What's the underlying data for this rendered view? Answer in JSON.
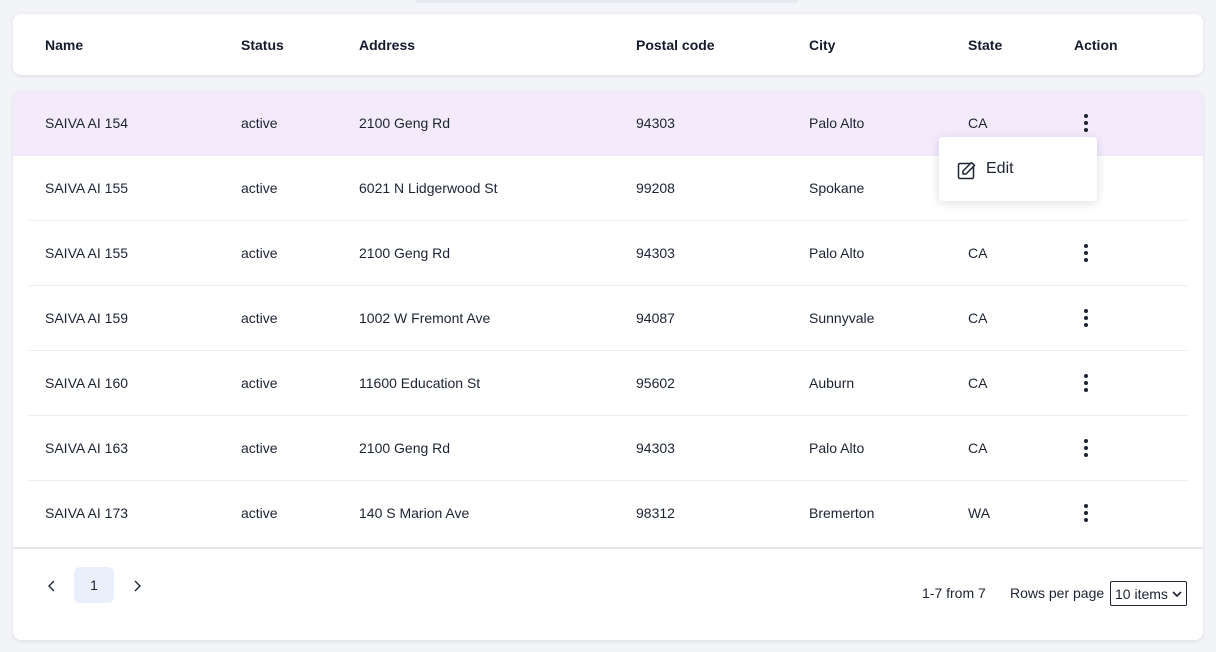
{
  "headers": {
    "name": "Name",
    "status": "Status",
    "address": "Address",
    "postal": "Postal code",
    "city": "City",
    "state": "State",
    "action": "Action"
  },
  "rows": [
    {
      "name": "SAIVA AI 154",
      "status": "active",
      "address": "2100 Geng Rd",
      "postal": "94303",
      "city": "Palo Alto",
      "state": "CA"
    },
    {
      "name": "SAIVA AI 155",
      "status": "active",
      "address": "6021 N Lidgerwood St",
      "postal": "99208",
      "city": "Spokane",
      "state": ""
    },
    {
      "name": "SAIVA AI 155",
      "status": "active",
      "address": "2100 Geng Rd",
      "postal": "94303",
      "city": "Palo Alto",
      "state": "CA"
    },
    {
      "name": "SAIVA AI 159",
      "status": "active",
      "address": "1002 W Fremont Ave",
      "postal": "94087",
      "city": "Sunnyvale",
      "state": "CA"
    },
    {
      "name": "SAIVA AI 160",
      "status": "active",
      "address": "11600 Education St",
      "postal": "95602",
      "city": "Auburn",
      "state": "CA"
    },
    {
      "name": "SAIVA AI 163",
      "status": "active",
      "address": "2100 Geng Rd",
      "postal": "94303",
      "city": "Palo Alto",
      "state": "CA"
    },
    {
      "name": "SAIVA AI 173",
      "status": "active",
      "address": "140 S Marion Ave",
      "postal": "98312",
      "city": "Bremerton",
      "state": "WA"
    }
  ],
  "menu": {
    "edit_label": "Edit"
  },
  "pagination": {
    "current_page": "1",
    "range_text": "1-7 from 7",
    "rows_per_page_label": "Rows per page",
    "rows_per_page_value": "10 items"
  },
  "icons": {
    "prev": "chevron-left-icon",
    "next": "chevron-right-icon",
    "action": "more-vertical-icon",
    "edit": "edit-icon",
    "dropdown": "chevron-down-icon"
  },
  "colors": {
    "highlight_row": "#f3ebfc",
    "active_page": "#e9effb",
    "text": "#1c2333"
  }
}
